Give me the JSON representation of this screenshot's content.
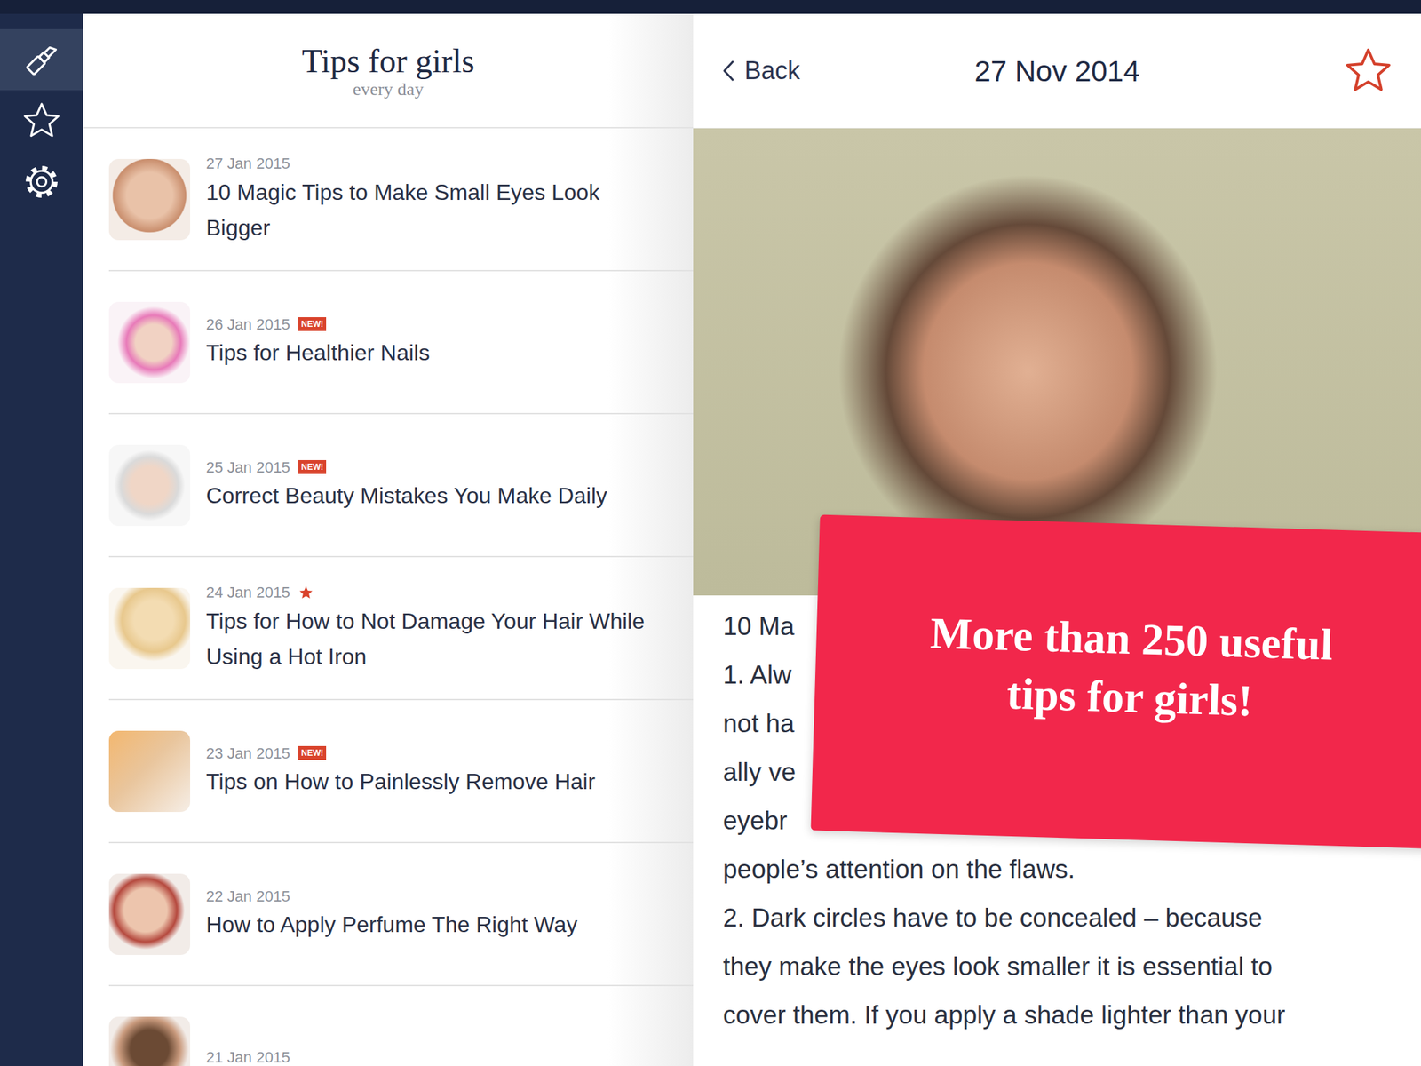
{
  "sidebar": {
    "items": [
      {
        "kind": "lipstick",
        "selected": true
      },
      {
        "kind": "favorites",
        "selected": false
      },
      {
        "kind": "settings",
        "selected": false
      }
    ]
  },
  "list": {
    "title": "Tips for girls",
    "subtitle": "every day",
    "items": [
      {
        "date": "27 Jan 2015",
        "starred": false,
        "title": "10 Magic Tips to Make Small Eyes Look Bigger"
      },
      {
        "date": "26 Jan 2015",
        "badge": "NEW!",
        "starred": false,
        "title": "Tips for Healthier Nails"
      },
      {
        "date": "25 Jan 2015",
        "badge": "NEW!",
        "starred": false,
        "title": "Correct Beauty Mistakes You Make Daily"
      },
      {
        "date": "24 Jan 2015",
        "starred": true,
        "title": "Tips for How to Not Damage Your Hair While Using a Hot Iron"
      },
      {
        "date": "23 Jan 2015",
        "badge": "NEW!",
        "starred": false,
        "title": "Tips on How to Painlessly Remove Hair"
      },
      {
        "date": "22 Jan 2015",
        "starred": false,
        "title": "How to Apply Perfume The Right Way"
      },
      {
        "date": "21 Jan 2015",
        "starred": false
      }
    ]
  },
  "article": {
    "back": "Back",
    "date": "27 Nov 2014",
    "starred": false,
    "lines": [
      "10 Ma",
      "1. Alw",
      "not ha",
      "ally ve",
      "eyebr",
      "people’s attention on the flaws.",
      "2. Dark circles have to be concealed – because",
      "they make the eyes look smaller it is essential to",
      "cover them. If you apply a shade lighter than your"
    ]
  },
  "promo": {
    "text": "More than 250 useful tips for girls!"
  }
}
